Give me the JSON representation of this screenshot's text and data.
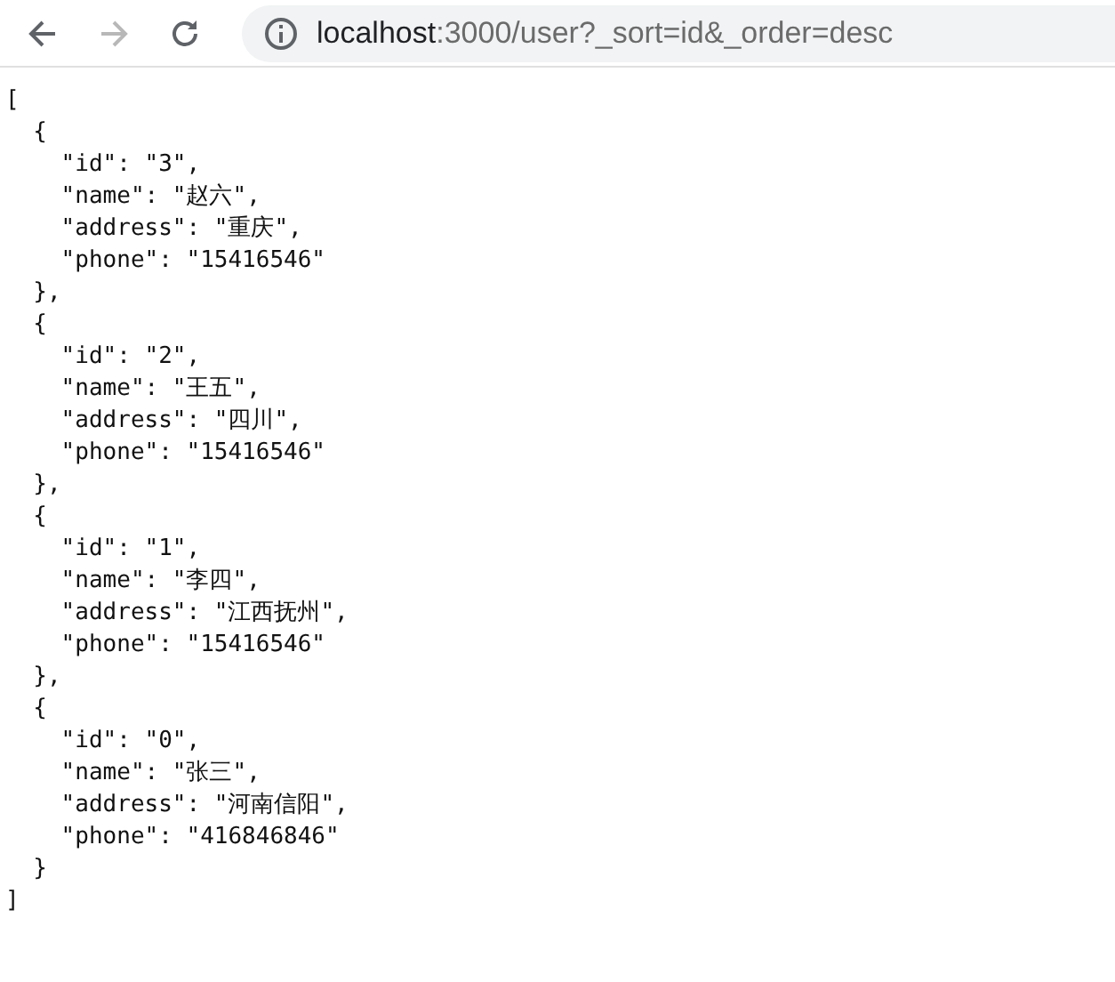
{
  "toolbar": {
    "back": {
      "disabled": false
    },
    "forward": {
      "disabled": true
    },
    "address": {
      "host": "localhost",
      "rest": ":3000/user?_sort=id&_order=desc"
    }
  },
  "document": {
    "lines": [
      "[",
      "  {",
      "    \"id\": \"3\",",
      "    \"name\": \"赵六\",",
      "    \"address\": \"重庆\",",
      "    \"phone\": \"15416546\"",
      "  },",
      "  {",
      "    \"id\": \"2\",",
      "    \"name\": \"王五\",",
      "    \"address\": \"四川\",",
      "    \"phone\": \"15416546\"",
      "  },",
      "  {",
      "    \"id\": \"1\",",
      "    \"name\": \"李四\",",
      "    \"address\": \"江西抚州\",",
      "    \"phone\": \"15416546\"",
      "  },",
      "  {",
      "    \"id\": \"0\",",
      "    \"name\": \"张三\",",
      "    \"address\": \"河南信阳\",",
      "    \"phone\": \"416846846\"",
      "  }",
      "]"
    ]
  }
}
